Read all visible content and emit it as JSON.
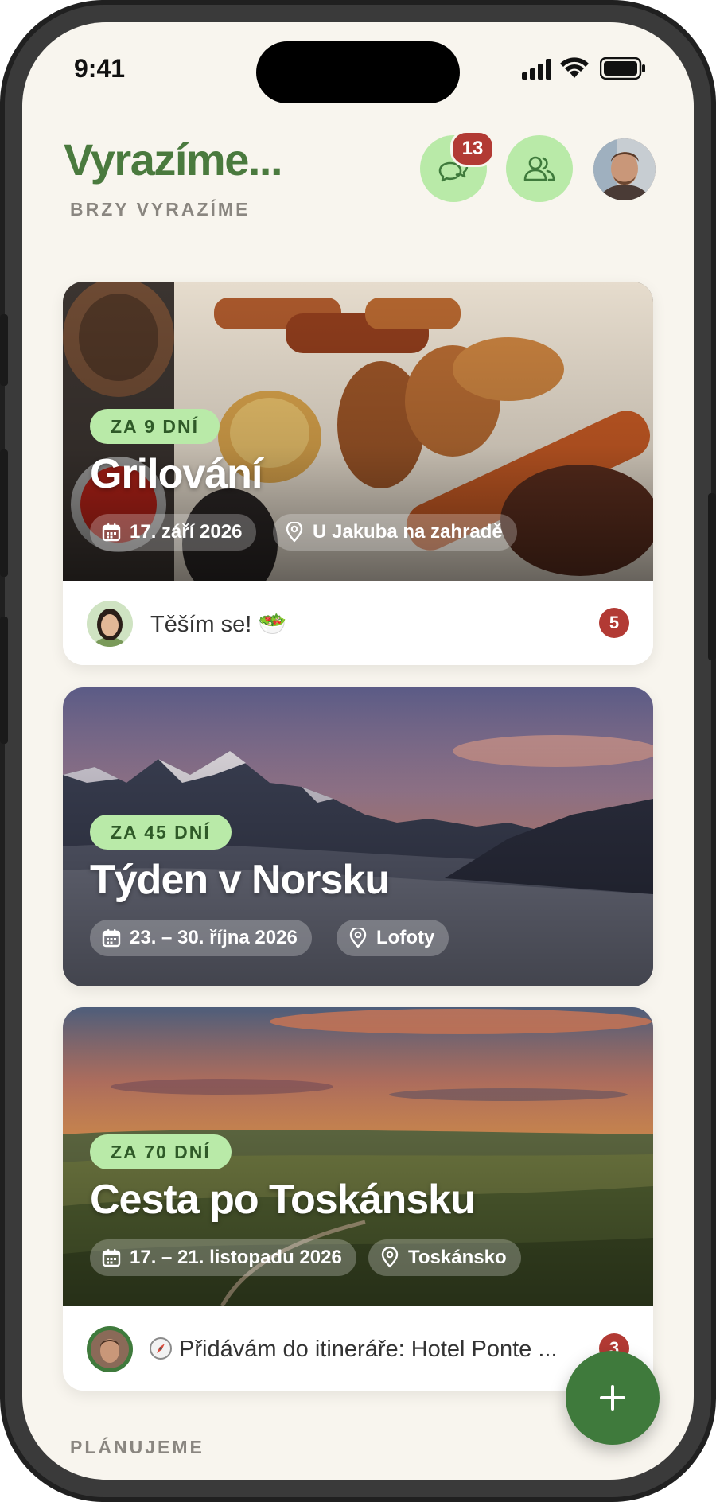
{
  "status_bar": {
    "time": "9:41"
  },
  "header": {
    "title": "Vyrazíme...",
    "chat_badge": "13",
    "icons": [
      "chat-bubbles-icon",
      "people-icon",
      "profile-avatar"
    ]
  },
  "sections": {
    "upcoming": "BRZY VYRAZÍME",
    "planning": "PLÁNUJEME"
  },
  "trips": [
    {
      "countdown": "ZA 9 DNÍ",
      "title": "Grilování",
      "date": "17. září 2026",
      "place": "U Jakuba na zahradě",
      "last_message": "Těším se! 🥗",
      "unread": "5"
    },
    {
      "countdown": "ZA 45 DNÍ",
      "title": "Týden v Norsku",
      "date": "23. – 30. října 2026",
      "place": "Lofoty"
    },
    {
      "countdown": "ZA 70 DNÍ",
      "title": "Cesta po Toskánsku",
      "date": "17. – 21. listopadu 2026",
      "place": "Toskánsko",
      "last_message": "Přidávám do itineráře: Hotel Ponte ...",
      "unread": "3"
    }
  ],
  "colors": {
    "accent_green": "#4a7a3e",
    "pill_green": "#b9eaa8",
    "badge_red": "#b23a34",
    "background": "#f8f5ee",
    "fab_green": "#3f7a3c"
  }
}
